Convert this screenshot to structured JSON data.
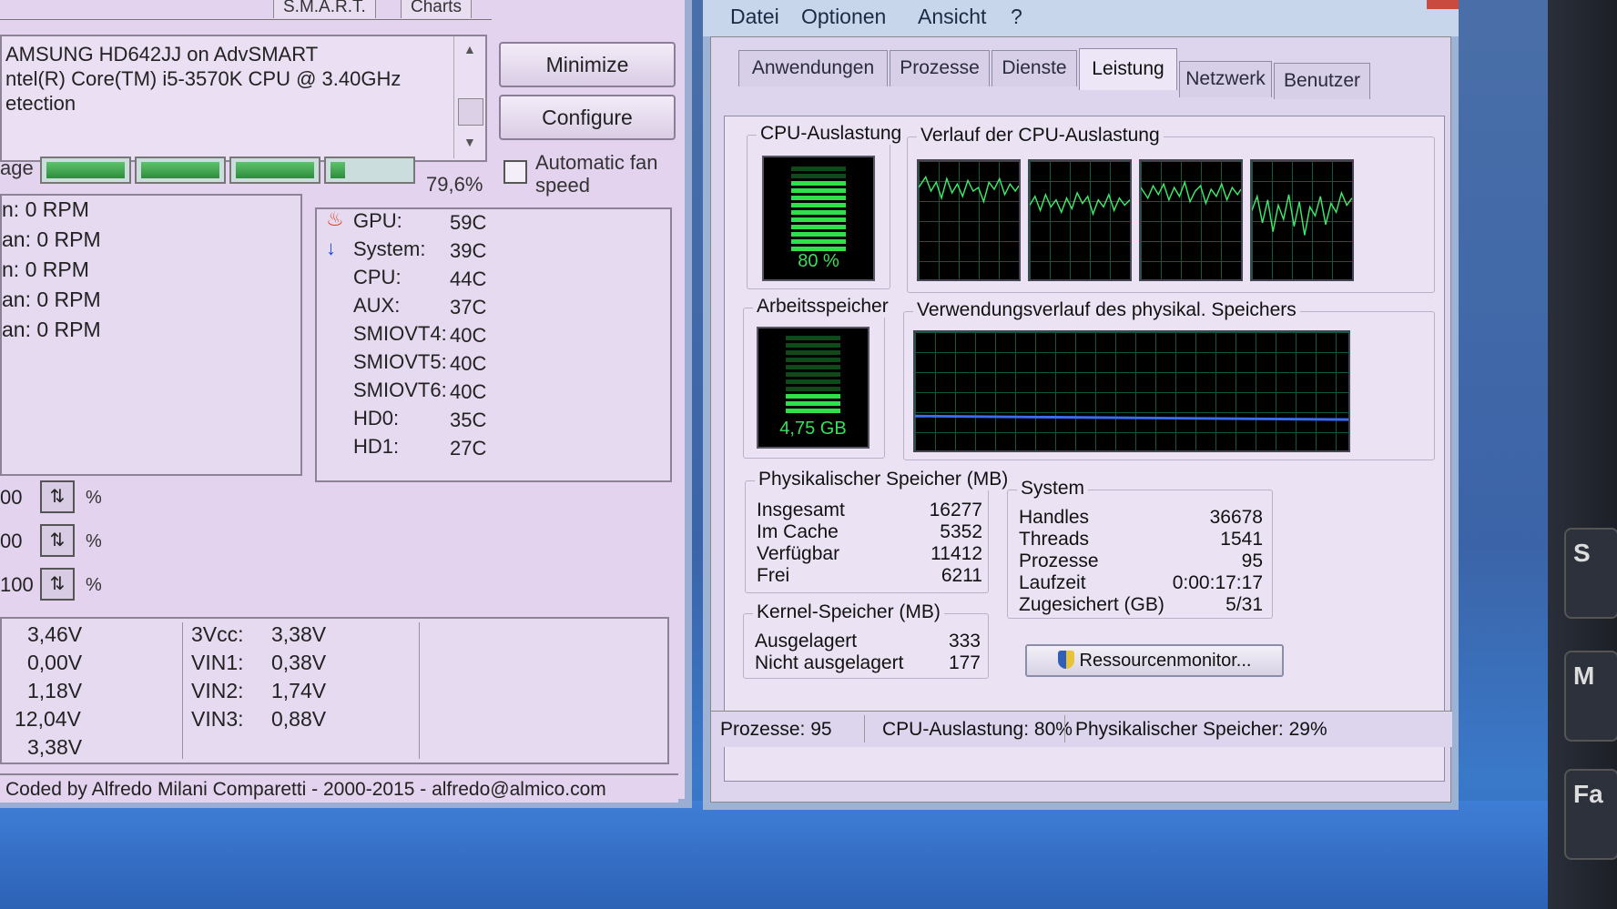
{
  "speedfan": {
    "tabs": [
      "S.M.A.R.T.",
      "Charts"
    ],
    "info_lines": [
      "AMSUNG HD642JJ on AdvSMART",
      "ntel(R) Core(TM) i5-3570K CPU @ 3.40GHz",
      "etection"
    ],
    "minimize_label": "Minimize",
    "configure_label": "Configure",
    "auto_fan_label": "Automatic fan speed",
    "usage_label": "age",
    "usage_percent": "79,6%",
    "usage_fraction": 0.796,
    "fans": [
      {
        "label": "n:",
        "value": "0 RPM"
      },
      {
        "label": "an:",
        "value": "0 RPM"
      },
      {
        "label": "n:",
        "value": "0 RPM"
      },
      {
        "label": "an:",
        "value": "0 RPM"
      },
      {
        "label": "an:",
        "value": "0 RPM"
      }
    ],
    "temps": [
      {
        "name": "GPU:",
        "value": "59C",
        "icon": "flame-icon"
      },
      {
        "name": "System:",
        "value": "39C",
        "icon": "arrow-down-icon"
      },
      {
        "name": "CPU:",
        "value": "44C"
      },
      {
        "name": "AUX:",
        "value": "37C"
      },
      {
        "name": "SMIOVT4:",
        "value": "40C"
      },
      {
        "name": "SMIOVT5:",
        "value": "40C"
      },
      {
        "name": "SMIOVT6:",
        "value": "40C"
      },
      {
        "name": "HD0:",
        "value": "35C"
      },
      {
        "name": "HD1:",
        "value": "27C"
      }
    ],
    "speeds": [
      {
        "value": "00",
        "unit": "%"
      },
      {
        "value": "00",
        "unit": "%"
      },
      {
        "value": "100",
        "unit": "%"
      }
    ],
    "voltages_left": [
      "3,46V",
      "0,00V",
      "1,18V",
      "12,04V",
      "3,38V"
    ],
    "voltages_mid": [
      {
        "name": "3Vcc:",
        "value": "3,38V"
      },
      {
        "name": "VIN1:",
        "value": "0,38V"
      },
      {
        "name": "VIN2:",
        "value": "1,74V"
      },
      {
        "name": "VIN3:",
        "value": "0,88V"
      }
    ],
    "status": "Coded by Alfredo Milani Comparetti - 2000-2015 - alfredo@almico.com"
  },
  "taskmanager": {
    "menu": [
      "Datei",
      "Optionen",
      "Ansicht",
      "?"
    ],
    "tabs": [
      "Anwendungen",
      "Prozesse",
      "Dienste",
      "Leistung",
      "Netzwerk",
      "Benutzer"
    ],
    "active_tab": "Leistung",
    "cpu_title": "CPU-Auslastung",
    "cpu_value": "80 %",
    "cpu_fraction": 0.8,
    "cpu_history_title": "Verlauf der CPU-Auslastung",
    "mem_title": "Arbeitsspeicher",
    "mem_value": "4,75 GB",
    "mem_fraction": 0.29,
    "mem_history_title": "Verwendungsverlauf des physikal. Speichers",
    "phys": {
      "title": "Physikalischer Speicher (MB)",
      "rows": [
        {
          "k": "Insgesamt",
          "v": "16277"
        },
        {
          "k": "Im Cache",
          "v": "5352"
        },
        {
          "k": "Verfügbar",
          "v": "11412"
        },
        {
          "k": "Frei",
          "v": "6211"
        }
      ]
    },
    "system": {
      "title": "System",
      "rows": [
        {
          "k": "Handles",
          "v": "36678"
        },
        {
          "k": "Threads",
          "v": "1541"
        },
        {
          "k": "Prozesse",
          "v": "95"
        },
        {
          "k": "Laufzeit",
          "v": "0:00:17:17"
        },
        {
          "k": "Zugesichert (GB)",
          "v": "5/31"
        }
      ]
    },
    "kernel": {
      "title": "Kernel-Speicher (MB)",
      "rows": [
        {
          "k": "Ausgelagert",
          "v": "333"
        },
        {
          "k": "Nicht ausgelagert",
          "v": "177"
        }
      ]
    },
    "resmon_label": "Ressourcenmonitor...",
    "status": {
      "processes": "Prozesse: 95",
      "cpu": "CPU-Auslastung: 80%",
      "memory": "Physikalischer Speicher: 29%"
    }
  },
  "desktop_tiles": [
    "S",
    "M",
    "Fa"
  ]
}
